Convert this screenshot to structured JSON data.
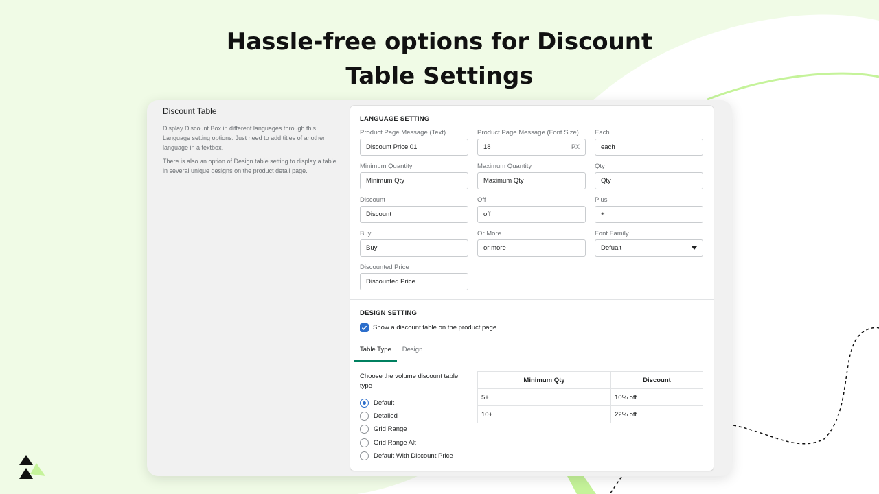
{
  "hero": {
    "line1": "Hassle-free options for Discount",
    "line2": "Table Settings"
  },
  "colors": {
    "background": "#f0fbe6",
    "accent_green": "#c5f39a",
    "primary_blue": "#2c6ecb",
    "tab_underline": "#008060"
  },
  "sidebar": {
    "title": "Discount Table",
    "paragraph1": "Display Discount Box in different languages through this Language setting options. Just need to add titles of another language in a textbox.",
    "paragraph2": "There is also an option of Design table setting to display a table in several unique designs on the product detail page."
  },
  "language_setting": {
    "heading": "LANGUAGE SETTING",
    "fields": [
      {
        "label": "Product Page Message (Text)",
        "value": "Discount Price 01"
      },
      {
        "label": "Product Page Message (Font Size)",
        "value": "18",
        "suffix": "PX"
      },
      {
        "label": "Each",
        "value": "each"
      },
      {
        "label": "Minimum Quantity",
        "value": "Minimum Qty"
      },
      {
        "label": "Maximum Quantity",
        "value": "Maximum Qty"
      },
      {
        "label": "Qty",
        "value": "Qty"
      },
      {
        "label": "Discount",
        "value": "Discount"
      },
      {
        "label": "Off",
        "value": "off"
      },
      {
        "label": "Plus",
        "value": "+"
      },
      {
        "label": "Buy",
        "value": "Buy"
      },
      {
        "label": "Or More",
        "value": "or more"
      },
      {
        "label": "Font Family",
        "value": "Defualt",
        "icon": "chevron-down-icon"
      },
      {
        "label": "Discounted Price",
        "value": "Discounted Price"
      }
    ]
  },
  "design_setting": {
    "heading": "DESIGN SETTING",
    "checkbox_label": "Show a discount table on the product page",
    "checkbox_checked": true,
    "tabs": [
      "Table Type",
      "Design"
    ],
    "active_tab": "Table Type",
    "choose_label": "Choose the volume discount table type",
    "radio_options": [
      "Default",
      "Detailed",
      "Grid Range",
      "Grid Range Alt",
      "Default With Discount Price"
    ],
    "selected_option": "Default",
    "table": {
      "headers": [
        "Minimum Qty",
        "Discount"
      ],
      "rows": [
        [
          "5+",
          "10% off"
        ],
        [
          "10+",
          "22% off"
        ]
      ]
    }
  }
}
